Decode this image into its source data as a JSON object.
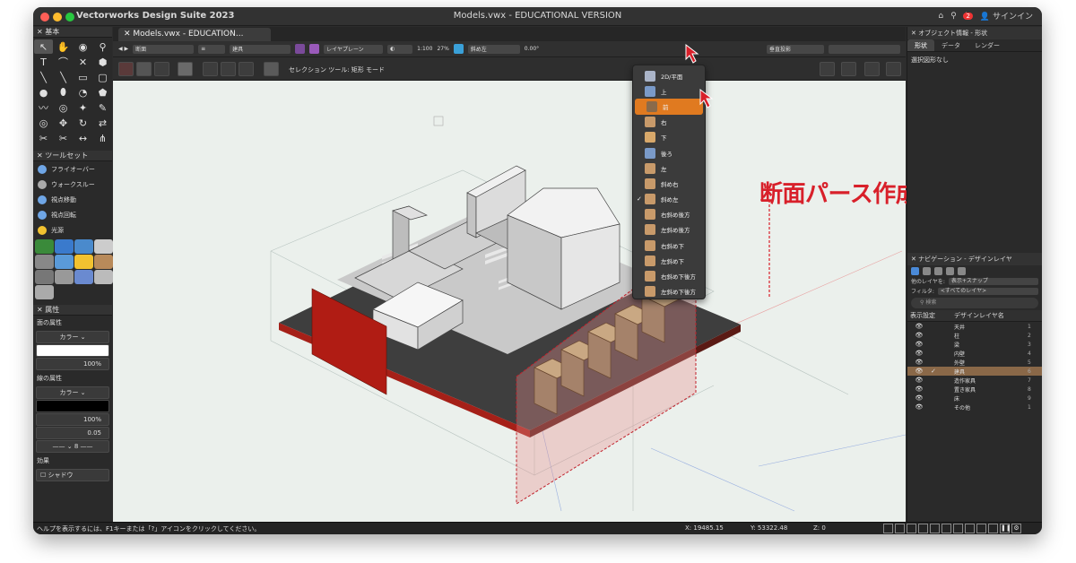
{
  "titlebar": {
    "app": "Vectorworks Design Suite 2023",
    "document": "Models.vwx - EDUCATIONAL VERSION",
    "notification_count": "2",
    "signin": "サインイン"
  },
  "tabs": {
    "document_tab": "Models.vwx - EDUCATION..."
  },
  "viewbar": {
    "class": "断面",
    "class2": "建具",
    "layer": "レイヤプレーン",
    "scale": "1:100",
    "zoom": "27%",
    "view": "斜め左",
    "angle": "0.00°",
    "projection": "垂直投影"
  },
  "modebar": {
    "mode_label": "セレクション ツール: 矩形 モード"
  },
  "left": {
    "basic_title": "基本",
    "toolsets_title": "ツールセット",
    "toolsets": [
      "フライオーバー",
      "ウォークスルー",
      "視点移動",
      "視点回転",
      "光源"
    ],
    "attributes_title": "属性",
    "fill_label": "面の属性",
    "fill_type": "カラー",
    "fill_opacity": "100%",
    "line_label": "線の属性",
    "line_type": "カラー",
    "line_opacity": "100%",
    "line_weight": "0.05",
    "effects_label": "効果",
    "shadow_label": "シャドウ"
  },
  "view_menu": {
    "items": [
      "2D/平面",
      "上",
      "前",
      "右",
      "下",
      "後ろ",
      "左",
      "斜め右",
      "斜め左",
      "右斜め後方",
      "左斜め後方",
      "右斜め下",
      "左斜め下",
      "右斜め下後方",
      "左斜め下後方"
    ],
    "active": "前",
    "checked": "斜め左"
  },
  "annotation": "断面パース作成面",
  "right": {
    "obj_info_title": "オブジェクト情報 - 形状",
    "tabs": [
      "形状",
      "データ",
      "レンダー"
    ],
    "no_selection": "選択図形なし",
    "nav_title": "ナビゲーション - デザインレイヤ",
    "other_layers_label": "他のレイヤを:",
    "other_layers_value": "表示+スナップ",
    "filter_label": "フィルタ:",
    "filter_value": "<すべてのレイヤ>",
    "search_placeholder": "検索",
    "col_display": "表示設定",
    "col_name": "デザインレイヤ名",
    "layers": [
      {
        "name": "天井",
        "num": "1"
      },
      {
        "name": "柱",
        "num": "2"
      },
      {
        "name": "梁",
        "num": "3"
      },
      {
        "name": "内壁",
        "num": "4"
      },
      {
        "name": "外壁",
        "num": "5"
      },
      {
        "name": "建具",
        "num": "6"
      },
      {
        "name": "造作家具",
        "num": "7"
      },
      {
        "name": "置き家具",
        "num": "8"
      },
      {
        "name": "床",
        "num": "9"
      },
      {
        "name": "その他",
        "num": "1"
      }
    ],
    "active_layer": "建具"
  },
  "status": {
    "help": "ヘルプを表示するには、F1キーまたは「?」アイコンをクリックしてください。",
    "x": "X: 19485.15",
    "y": "Y: 53322.48",
    "z": "Z: 0"
  },
  "colors": {
    "accent": "#e07a20",
    "annotation": "#d8202a",
    "section_plane": "#e8a0a0"
  }
}
